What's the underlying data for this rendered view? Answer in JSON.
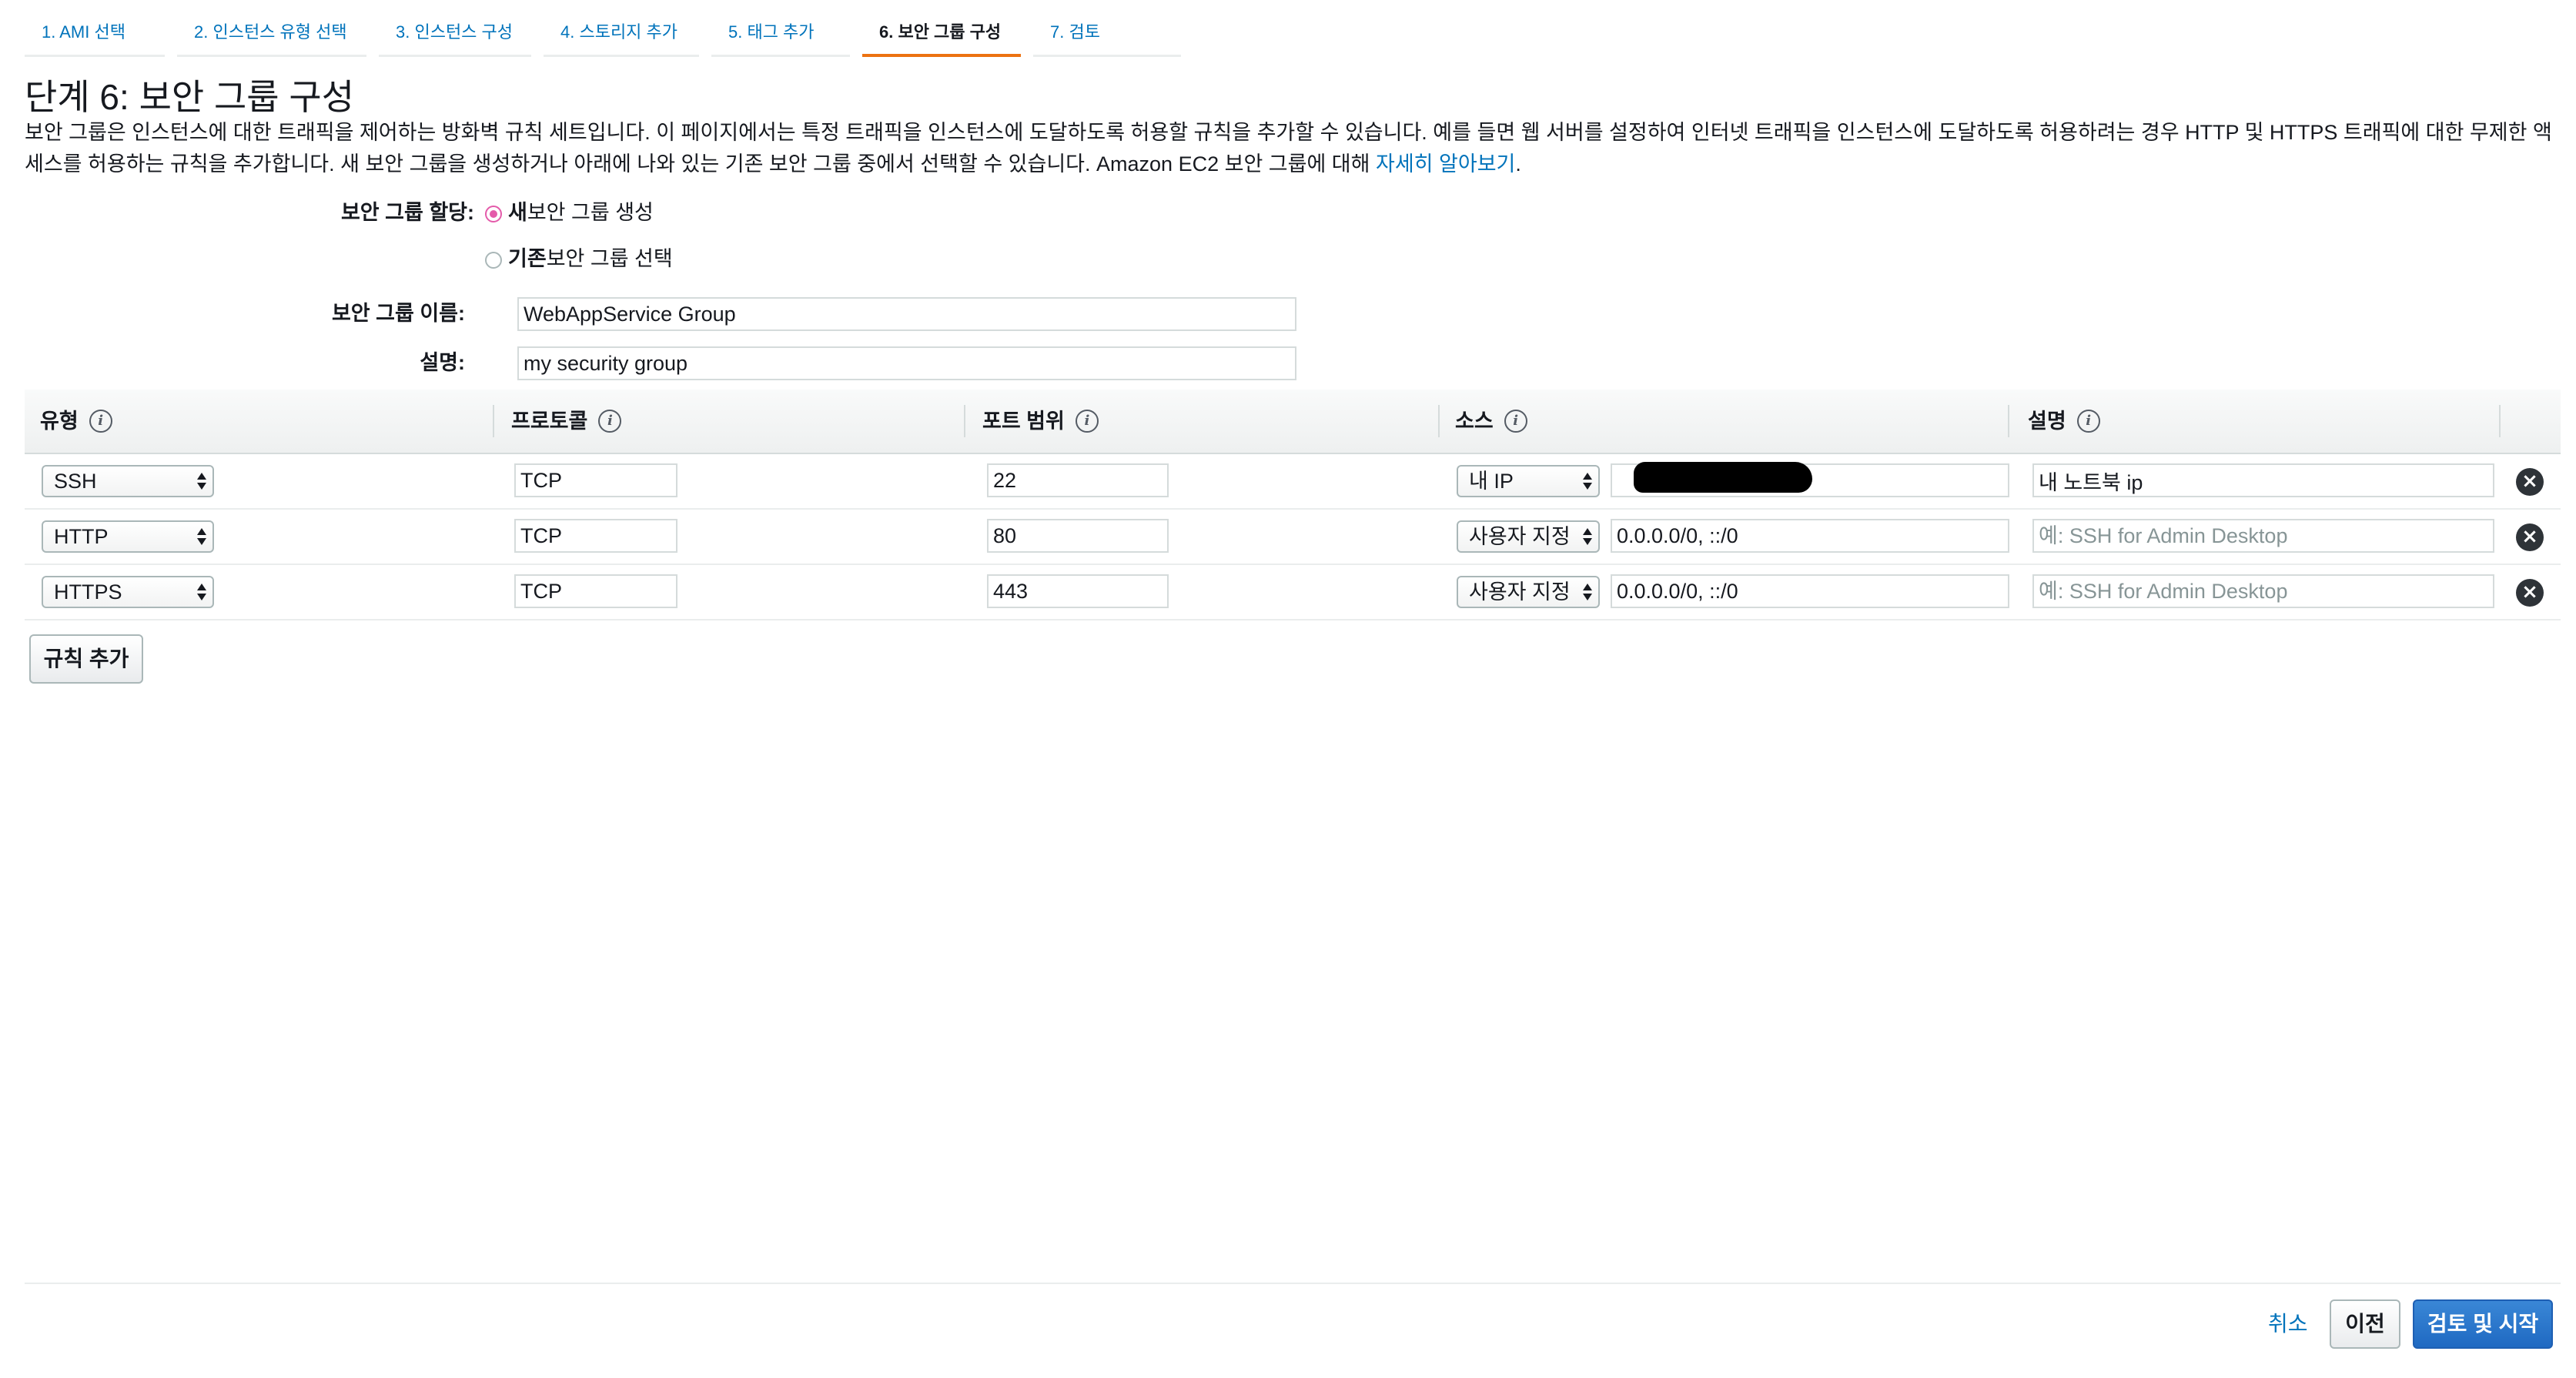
{
  "tabs": [
    {
      "label": "1. AMI 선택"
    },
    {
      "label": "2. 인스턴스 유형 선택"
    },
    {
      "label": "3. 인스턴스 구성"
    },
    {
      "label": "4. 스토리지 추가"
    },
    {
      "label": "5. 태그 추가"
    },
    {
      "label": "6. 보안 그룹 구성"
    },
    {
      "label": "7. 검토"
    }
  ],
  "active_tab_index": 5,
  "page_title": "단계 6: 보안 그룹 구성",
  "description": {
    "text": "보안 그룹은 인스턴스에 대한 트래픽을 제어하는 방화벽 규칙 세트입니다. 이 페이지에서는 특정 트래픽을 인스턴스에 도달하도록 허용할 규칙을 추가할 수 있습니다. 예를 들면 웹 서버를 설정하여 인터넷 트래픽을 인스턴스에 도달하도록 허용하려는 경우 HTTP 및 HTTPS 트래픽에 대한 무제한 액세스를 허용하는 규칙을 추가합니다. 새 보안 그룹을 생성하거나 아래에 나와 있는 기존 보안 그룹 중에서 선택할 수 있습니다. Amazon EC2 보안 그룹에 대해 ",
    "link": "자세히 알아보기",
    "suffix": "."
  },
  "form": {
    "assign_label": "보안 그룹 할당:",
    "radio_new_bold": "새",
    "radio_new_rest": " 보안 그룹 생성",
    "radio_existing_bold": "기존",
    "radio_existing_rest": " 보안 그룹 선택",
    "selected_option": "new",
    "name_label": "보안 그룹 이름:",
    "name_value": "WebAppService Group",
    "desc_label": "설명:",
    "desc_value": "my security group"
  },
  "table": {
    "headers": {
      "type": "유형",
      "protocol": "프로토콜",
      "port_range": "포트 범위",
      "source": "소스",
      "description": "설명"
    },
    "rows": [
      {
        "type": "SSH",
        "protocol": "TCP",
        "port": "22",
        "source_type": "내 IP",
        "source_value": "",
        "description_value": "내 노트북 ip",
        "description_placeholder": "예: SSH for Admin Desktop"
      },
      {
        "type": "HTTP",
        "protocol": "TCP",
        "port": "80",
        "source_type": "사용자 지정",
        "source_value": "0.0.0.0/0, ::/0",
        "description_value": "",
        "description_placeholder": "예: SSH for Admin Desktop"
      },
      {
        "type": "HTTPS",
        "protocol": "TCP",
        "port": "443",
        "source_type": "사용자 지정",
        "source_value": "0.0.0.0/0, ::/0",
        "description_value": "",
        "description_placeholder": "예: SSH for Admin Desktop"
      }
    ]
  },
  "add_rule_label": "규칙 추가",
  "footer": {
    "cancel_label": "취소",
    "previous_label": "이전",
    "review_launch_label": "검토 및 시작"
  },
  "colors": {
    "link": "#0073bb",
    "active_tab_underline": "#ec7211",
    "primary_button": "#1f69c2",
    "radio_selected": "#e45baa"
  }
}
